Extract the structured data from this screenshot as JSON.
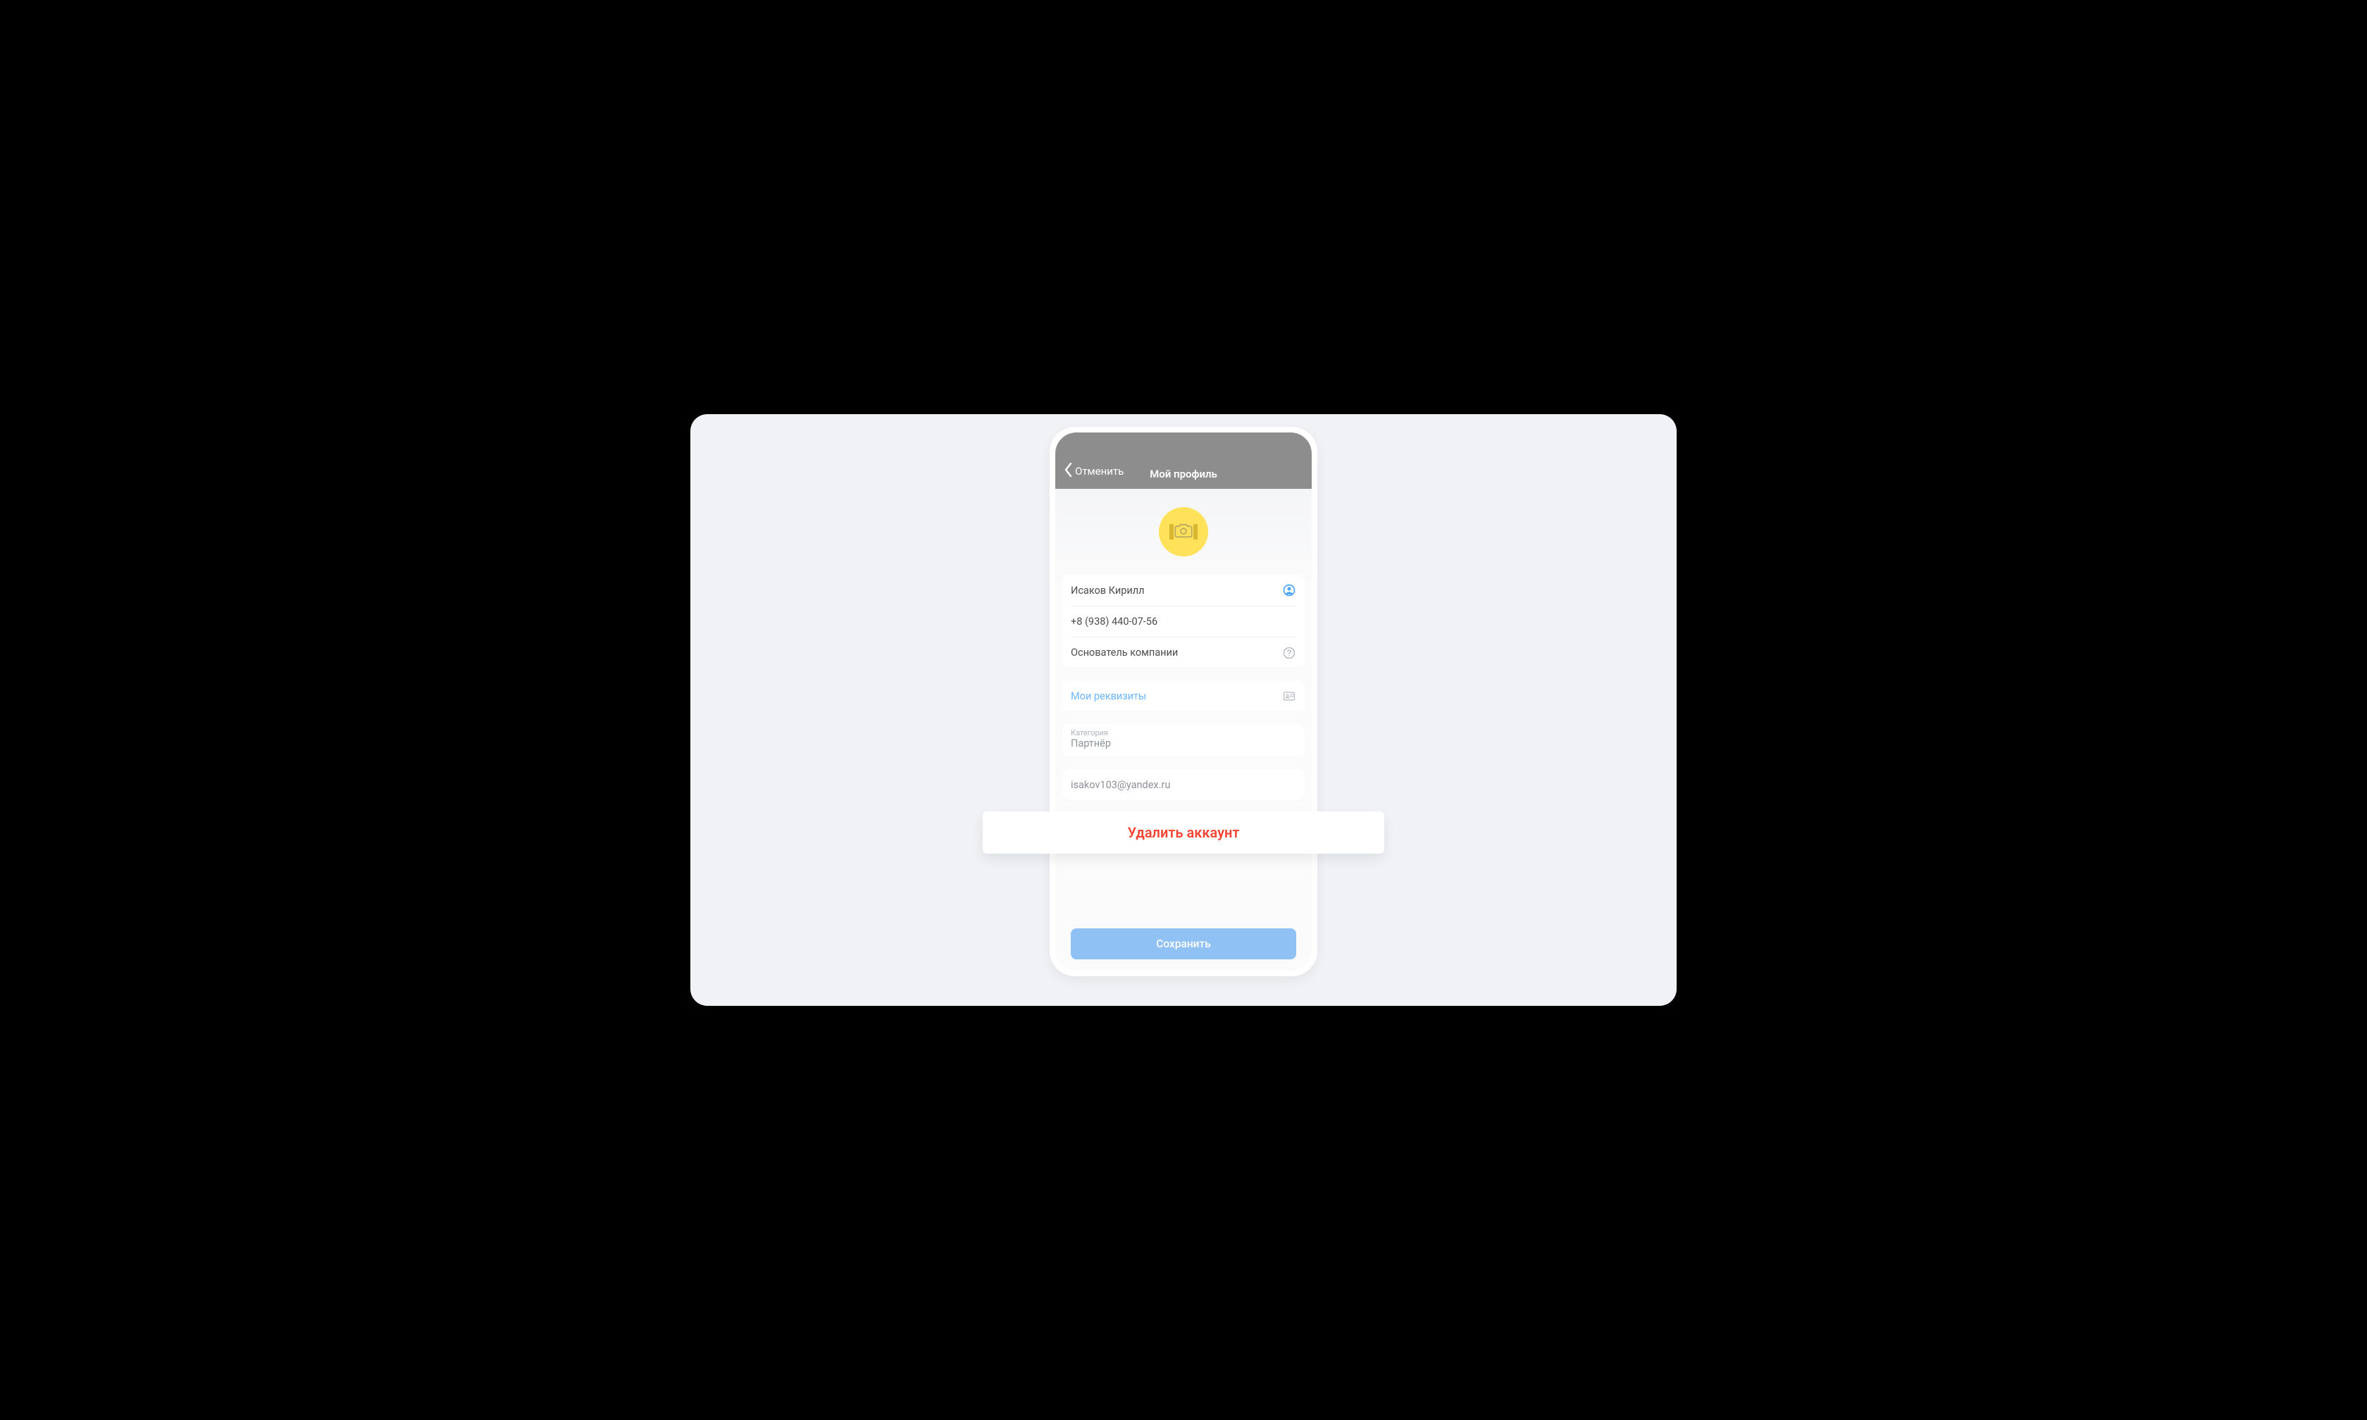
{
  "header": {
    "back_label": "Отменить",
    "title": "Мой профиль"
  },
  "profile": {
    "name": "Исаков Кирилл",
    "phone": "+8 (938) 440-07-56",
    "role": "Основатель компании"
  },
  "requisites": {
    "link_label": "Мои реквизиты"
  },
  "category": {
    "label": "Категория",
    "value": "Партнёр"
  },
  "email": {
    "value": "isakov103@yandex.ru"
  },
  "actions": {
    "save_label": "Сохранить",
    "delete_label": "Удалить аккаунт"
  },
  "colors": {
    "accent_blue": "#8fc1f4",
    "danger": "#f44535",
    "avatar_bg": "#ffe15a"
  }
}
